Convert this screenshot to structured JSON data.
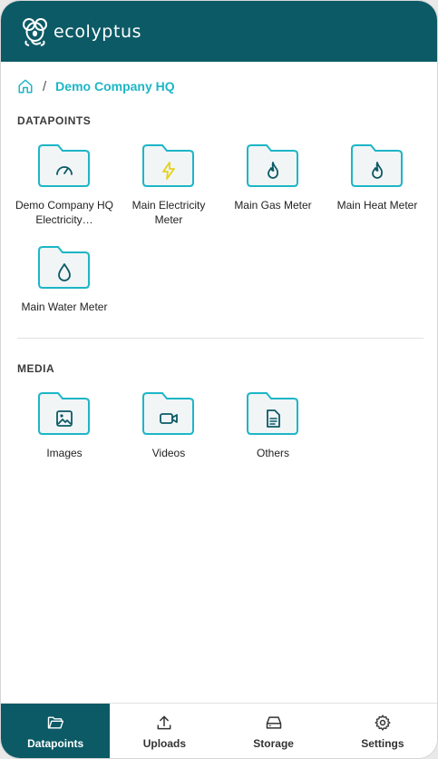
{
  "app": {
    "brand": "ecolyptus",
    "brand_icon": "koala-logo-icon",
    "accent": "#1cb6c6",
    "primary": "#0c5a66"
  },
  "breadcrumb": {
    "home_icon": "home-icon",
    "separator": "/",
    "current": "Demo Company HQ"
  },
  "datapoints": {
    "title": "DATAPOINTS",
    "items": [
      {
        "label": "Demo Company HQ Electricity…",
        "icon": "gauge-icon"
      },
      {
        "label": "Main Electricity Meter",
        "icon": "lightning-icon"
      },
      {
        "label": "Main Gas Meter",
        "icon": "flame-icon"
      },
      {
        "label": "Main Heat Meter",
        "icon": "flame-icon"
      },
      {
        "label": "Main Water Meter",
        "icon": "droplet-icon"
      }
    ]
  },
  "media": {
    "title": "MEDIA",
    "items": [
      {
        "label": "Images",
        "icon": "image-icon"
      },
      {
        "label": "Videos",
        "icon": "video-icon"
      },
      {
        "label": "Others",
        "icon": "document-icon"
      }
    ]
  },
  "bottom_nav": [
    {
      "label": "Datapoints",
      "icon": "folder-open-icon",
      "active": true
    },
    {
      "label": "Uploads",
      "icon": "upload-icon",
      "active": false
    },
    {
      "label": "Storage",
      "icon": "hard-drive-icon",
      "active": false
    },
    {
      "label": "Settings",
      "icon": "gear-icon",
      "active": false
    }
  ]
}
